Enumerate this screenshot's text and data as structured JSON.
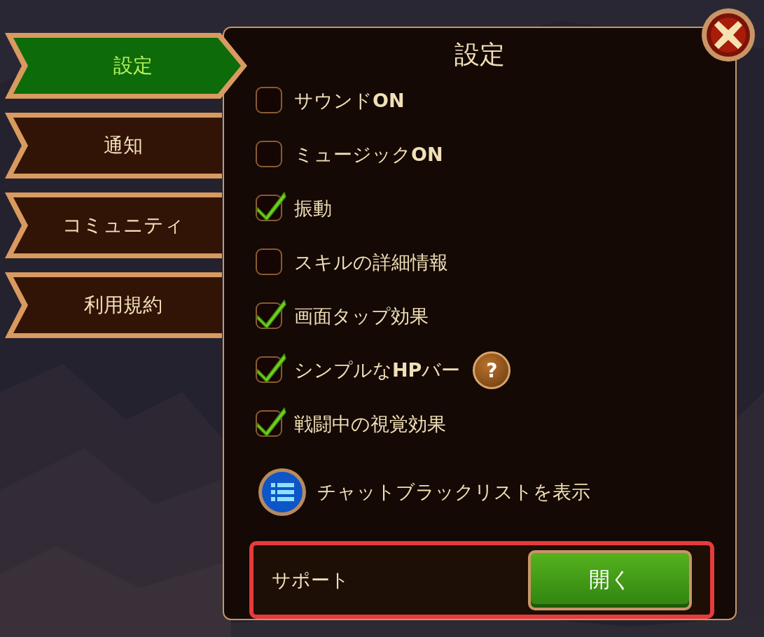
{
  "tabs": [
    {
      "label": "設定",
      "selected": true
    },
    {
      "label": "通知",
      "selected": false
    },
    {
      "label": "コミュニティ",
      "selected": false
    },
    {
      "label": "利用規約",
      "selected": false
    }
  ],
  "panel": {
    "title": "設定",
    "options": [
      {
        "kind": "checkbox",
        "label": "サウンド**ON**",
        "checked": false
      },
      {
        "kind": "checkbox",
        "label": "ミュージック**ON**",
        "checked": false
      },
      {
        "kind": "checkbox",
        "label": "振動",
        "checked": true
      },
      {
        "kind": "checkbox",
        "label": "スキルの詳細情報",
        "checked": false
      },
      {
        "kind": "checkbox",
        "label": "画面タップ効果",
        "checked": true
      },
      {
        "kind": "checkbox",
        "label": "シンプルな**HP**バー",
        "checked": true,
        "help": "?"
      },
      {
        "kind": "checkbox",
        "label": "戦闘中の視覚効果",
        "checked": true
      },
      {
        "kind": "link",
        "label": "チャットブラックリストを表示"
      }
    ],
    "support": {
      "label": "サポート",
      "button": "開く",
      "highlighted": true
    }
  }
}
